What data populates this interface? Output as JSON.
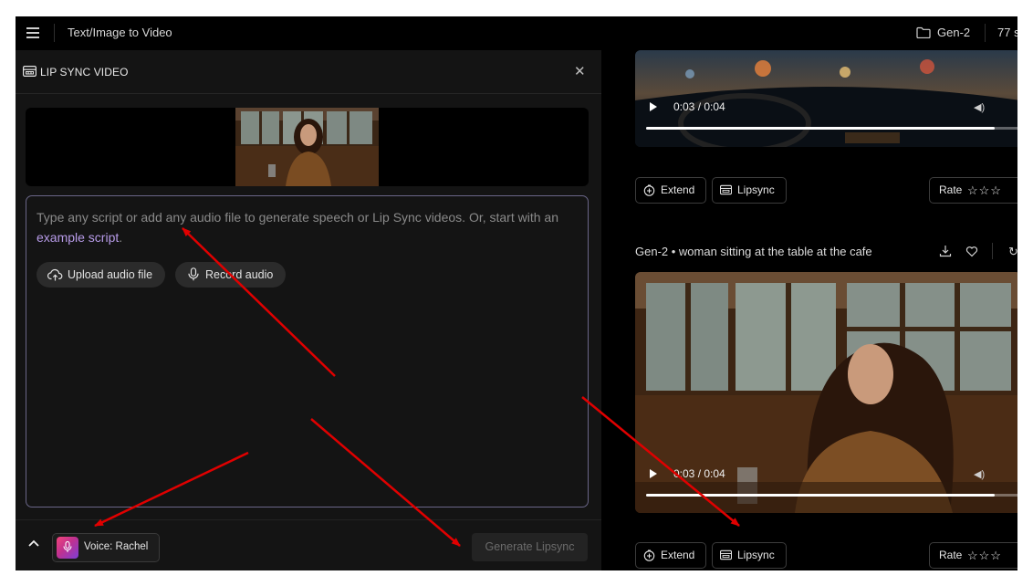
{
  "header": {
    "breadcrumb": "Text/Image to Video",
    "project": "Gen-2",
    "credits": "77 s"
  },
  "panel": {
    "title": "LIP SYNC VIDEO",
    "close_glyph": "✕",
    "placeholder_text": "Type any script or add any audio file to generate speech or Lip Sync videos. Or, start with an",
    "example_link": "example script",
    "example_suffix": ".",
    "upload_label": "Upload audio file",
    "record_label": "Record audio",
    "voice_label": "Voice: Rachel",
    "generate_label": "Generate Lipsync"
  },
  "videos": [
    {
      "time": "0:03 / 0:04",
      "progress": 0.93,
      "extend_label": "Extend",
      "lipsync_label": "Lipsync",
      "rate_label": "Rate",
      "stars": "☆☆☆"
    },
    {
      "title": "Gen-2 • woman sitting at the table at the cafe",
      "time": "0:03 / 0:04",
      "progress": 0.93,
      "extend_label": "Extend",
      "lipsync_label": "Lipsync",
      "rate_label": "Rate",
      "stars": "☆☆☆"
    }
  ],
  "colors": {
    "accent_link": "#b79be8",
    "textarea_border": "#6a6688",
    "annotation_arrow": "#e00000"
  },
  "icons": [
    "menu-icon",
    "folder-icon",
    "lipsync-icon",
    "close-icon",
    "upload-cloud-icon",
    "microphone-icon",
    "chevron-up-icon",
    "voice-avatar-icon",
    "play-icon",
    "volume-icon",
    "extend-icon",
    "star-icon",
    "download-icon",
    "heart-icon",
    "annotation-arrow"
  ]
}
